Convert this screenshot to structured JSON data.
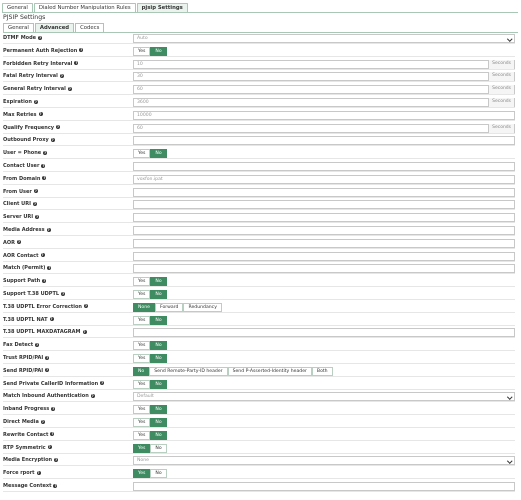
{
  "top_tabs": [
    {
      "label": "General",
      "active": false
    },
    {
      "label": "Dialed Number Manipulation Rules",
      "active": false
    },
    {
      "label": "pjsip Settings",
      "active": true
    }
  ],
  "section_title": "PJSIP Settings",
  "sub_tabs": [
    {
      "label": "General",
      "active": false
    },
    {
      "label": "Advanced",
      "active": true
    },
    {
      "label": "Codecs",
      "active": false
    }
  ],
  "fields": [
    {
      "label": "DTMF Mode",
      "type": "select",
      "value": "Auto"
    },
    {
      "label": "Permanent Auth Rejection",
      "type": "toggle",
      "options": [
        "Yes",
        "No"
      ],
      "selected": 1
    },
    {
      "label": "Forbidden Retry Interval",
      "type": "unit",
      "value": "10",
      "unit": "Seconds"
    },
    {
      "label": "Fatal Retry Interval",
      "type": "unit",
      "value": "30",
      "unit": "Seconds"
    },
    {
      "label": "General Retry Interval",
      "type": "unit",
      "value": "60",
      "unit": "Seconds"
    },
    {
      "label": "Expiration",
      "type": "unit",
      "value": "3600",
      "unit": "Seconds"
    },
    {
      "label": "Max Retries",
      "type": "text",
      "value": "10000"
    },
    {
      "label": "Qualify Frequency",
      "type": "unit",
      "value": "60",
      "unit": "Seconds"
    },
    {
      "label": "Outbound Proxy",
      "type": "text",
      "value": ""
    },
    {
      "label": "User = Phone",
      "type": "toggle",
      "options": [
        "Yes",
        "No"
      ],
      "selected": 1
    },
    {
      "label": "Contact User",
      "type": "text",
      "value": ""
    },
    {
      "label": "From Domain",
      "type": "text",
      "value": "voxfon.ipat"
    },
    {
      "label": "From User",
      "type": "text",
      "value": ""
    },
    {
      "label": "Client URI",
      "type": "text",
      "value": ""
    },
    {
      "label": "Server URI",
      "type": "text",
      "value": ""
    },
    {
      "label": "Media Address",
      "type": "text",
      "value": ""
    },
    {
      "label": "AOR",
      "type": "text",
      "value": ""
    },
    {
      "label": "AOR Contact",
      "type": "text",
      "value": ""
    },
    {
      "label": "Match (Permit)",
      "type": "text",
      "value": ""
    },
    {
      "label": "Support Path",
      "type": "toggle",
      "options": [
        "Yes",
        "No"
      ],
      "selected": 1
    },
    {
      "label": "Support T.38 UDPTL",
      "type": "toggle",
      "options": [
        "Yes",
        "No"
      ],
      "selected": 1
    },
    {
      "label": "T.38 UDPTL Error Correction",
      "type": "toggle",
      "options": [
        "None",
        "Forward",
        "Redundancy"
      ],
      "selected": 0
    },
    {
      "label": "T.38 UDPTL NAT",
      "type": "toggle",
      "options": [
        "Yes",
        "No"
      ],
      "selected": 1
    },
    {
      "label": "T.38 UDPTL MAXDATAGRAM",
      "type": "text",
      "value": ""
    },
    {
      "label": "Fax Detect",
      "type": "toggle",
      "options": [
        "Yes",
        "No"
      ],
      "selected": 1
    },
    {
      "label": "Trust RPID/PAI",
      "type": "toggle",
      "options": [
        "Yes",
        "No"
      ],
      "selected": 1
    },
    {
      "label": "Send RPID/PAI",
      "type": "toggle",
      "options": [
        "No",
        "Send Remote-Party-ID header",
        "Send P-Asserted-Identity header",
        "Both"
      ],
      "selected": 0
    },
    {
      "label": "Send Private CallerID Information",
      "type": "toggle",
      "options": [
        "Yes",
        "No"
      ],
      "selected": 1
    },
    {
      "label": "Match Inbound Authentication",
      "type": "select",
      "value": "Default"
    },
    {
      "label": "Inband Progress",
      "type": "toggle",
      "options": [
        "Yes",
        "No"
      ],
      "selected": 1
    },
    {
      "label": "Direct Media",
      "type": "toggle",
      "options": [
        "Yes",
        "No"
      ],
      "selected": 1
    },
    {
      "label": "Rewrite Contact",
      "type": "toggle",
      "options": [
        "Yes",
        "No"
      ],
      "selected": 1
    },
    {
      "label": "RTP Symmetric",
      "type": "toggle",
      "options": [
        "Yes",
        "No"
      ],
      "selected": 0
    },
    {
      "label": "Media Encryption",
      "type": "select",
      "value": "None"
    },
    {
      "label": "Force rport",
      "type": "toggle",
      "options": [
        "Yes",
        "No"
      ],
      "selected": 0
    },
    {
      "label": "Message Context",
      "type": "text",
      "value": ""
    }
  ]
}
